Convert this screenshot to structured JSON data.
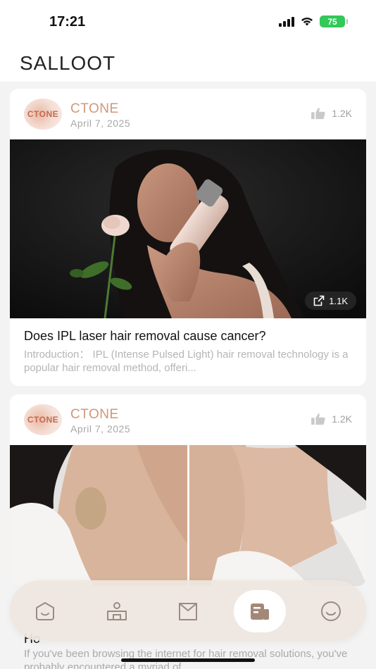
{
  "status": {
    "time": "17:21",
    "battery": "75"
  },
  "header": {
    "title": "SALLOOT"
  },
  "posts": [
    {
      "avatar_text": "CTONE",
      "author": "CTONE",
      "date": "April 7, 2025",
      "likes": "1.2K",
      "shares": "1.1K",
      "title": "Does IPL laser hair removal cause cancer?",
      "intro": "Introduction： IPL (Intense Pulsed Light) hair removal technology is a popular hair removal method, offeri..."
    },
    {
      "avatar_text": "CTONE",
      "author": "CTONE",
      "date": "April 7, 2025",
      "likes": "1.2K",
      "title": "Ho",
      "intro": "If you've been browsing the internet for hair removal solutions, you've probably encountered a myriad of..."
    }
  ],
  "tabbar": {
    "tabs": [
      {
        "icon": "face-icon",
        "active": false
      },
      {
        "icon": "person-icon",
        "active": false
      },
      {
        "icon": "bag-icon",
        "active": false
      },
      {
        "icon": "article-icon",
        "active": true
      },
      {
        "icon": "smile-icon",
        "active": false
      }
    ]
  },
  "colors": {
    "accent": "#d0977a",
    "background": "#f3f3f4",
    "battery": "#34c759",
    "tabbar": "#eee6e0"
  }
}
